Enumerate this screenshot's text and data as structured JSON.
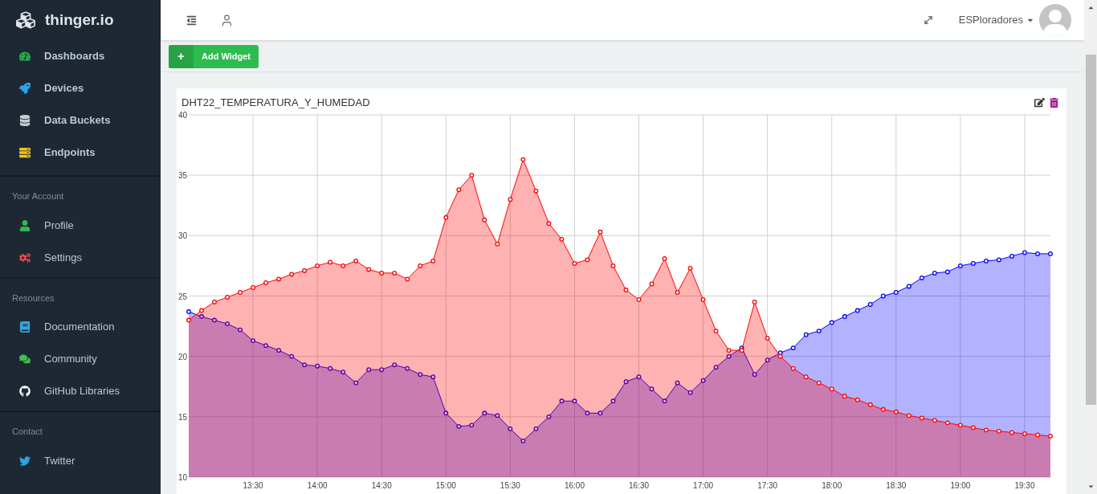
{
  "sidebar": {
    "brand": "thinger.io",
    "sections": [
      {
        "items": [
          "Dashboards",
          "Devices",
          "Data Buckets",
          "Endpoints"
        ]
      },
      {
        "title": "Your Account",
        "items": [
          "Profile",
          "Settings"
        ]
      },
      {
        "title": "Resources",
        "items": [
          "Documentation",
          "Community",
          "GitHub Libraries"
        ]
      },
      {
        "title": "Contact",
        "items": [
          "Twitter"
        ]
      }
    ]
  },
  "topbar": {
    "user": "ESPloradores"
  },
  "toolbar": {
    "add_button": "Add Widget",
    "add_icon": "+"
  },
  "widget": {
    "title": "DHT22_TEMPERATURA_Y_HUMEDAD",
    "chart_data": {
      "type": "area",
      "categories": [
        null,
        null,
        null,
        null,
        null,
        "13:30",
        null,
        null,
        null,
        null,
        "14:00",
        null,
        null,
        null,
        null,
        "14:30",
        null,
        null,
        null,
        null,
        "15:00",
        null,
        null,
        null,
        null,
        "15:30",
        null,
        null,
        null,
        null,
        "16:00",
        null,
        null,
        null,
        null,
        "16:30",
        null,
        null,
        null,
        null,
        "17:00",
        null,
        null,
        null,
        null,
        "17:30",
        null,
        null,
        null,
        null,
        "18:00",
        null,
        null,
        null,
        null,
        "18:30",
        null,
        null,
        null,
        null,
        "19:00",
        null,
        null,
        null,
        null,
        "19:30",
        null,
        null
      ],
      "series": [
        {
          "color": "#ff0000",
          "values": [
            23.0,
            23.8,
            24.5,
            24.9,
            25.3,
            25.7,
            26.1,
            26.4,
            26.8,
            27.1,
            27.5,
            27.8,
            27.5,
            27.9,
            27.2,
            26.9,
            26.9,
            26.4,
            27.5,
            27.9,
            31.5,
            33.8,
            35.0,
            31.3,
            29.3,
            33.0,
            36.3,
            33.7,
            31.0,
            29.7,
            27.7,
            28.0,
            30.3,
            27.5,
            25.5,
            24.7,
            26.0,
            28.1,
            25.3,
            27.3,
            24.7,
            22.1,
            20.5,
            20.5,
            24.5,
            21.5,
            20.0,
            19.0,
            18.3,
            17.8,
            17.3,
            16.7,
            16.4,
            16.0,
            15.6,
            15.4,
            15.1,
            14.9,
            14.7,
            14.5,
            14.3,
            14.1,
            13.9,
            13.8,
            13.7,
            13.6,
            13.5,
            13.4
          ]
        },
        {
          "color": "#0000ff",
          "values": [
            23.7,
            23.3,
            23.0,
            22.7,
            22.2,
            21.3,
            20.9,
            20.5,
            20.0,
            19.3,
            19.2,
            19.0,
            18.7,
            17.8,
            18.9,
            18.9,
            19.3,
            19.0,
            18.5,
            18.3,
            15.3,
            14.2,
            14.3,
            15.3,
            15.1,
            14.0,
            13.0,
            14.0,
            15.0,
            16.3,
            16.3,
            15.3,
            15.3,
            16.3,
            17.9,
            18.3,
            17.3,
            16.3,
            17.8,
            17.0,
            18.0,
            19.1,
            20.0,
            20.7,
            18.5,
            19.7,
            20.3,
            20.7,
            21.8,
            22.1,
            22.8,
            23.3,
            23.8,
            24.3,
            25.0,
            25.3,
            25.8,
            26.5,
            26.9,
            27.0,
            27.5,
            27.7,
            27.9,
            28.0,
            28.3,
            28.6,
            28.5,
            28.5
          ]
        }
      ],
      "ylim": [
        10,
        40
      ],
      "grid": true,
      "yticks": [
        10,
        15,
        20,
        25,
        30,
        35,
        40
      ]
    }
  }
}
